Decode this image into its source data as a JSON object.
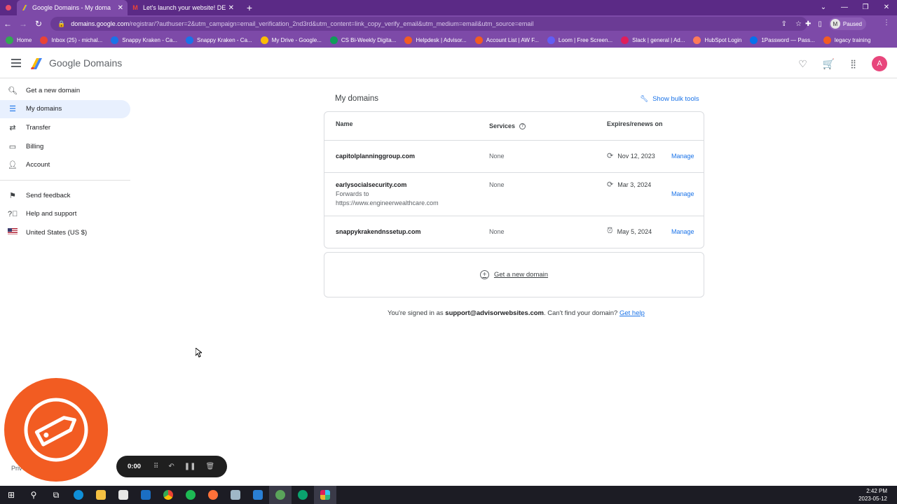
{
  "browser": {
    "tabs": [
      {
        "title": "Google Domains - My doma",
        "favicon": "google-domains-icon",
        "active": true
      },
      {
        "title": "Let's launch your website! DEMO",
        "favicon": "gmail-icon",
        "active": false
      }
    ],
    "url_host": "domains.google.com",
    "url_path": "/registrar/?authuser=2&utm_campaign=email_verification_2nd3rd&utm_content=link_copy_verify_email&utm_medium=email&utm_source=email",
    "profile_initial": "M",
    "profile_status": "Paused",
    "bookmarks": [
      {
        "label": "Home",
        "color": "#34a853"
      },
      {
        "label": "Inbox (25) - michal...",
        "color": "#ea4335"
      },
      {
        "label": "Snappy Kraken - Ca...",
        "color": "#1a73e8"
      },
      {
        "label": "Snappy Kraken - Ca...",
        "color": "#1a73e8"
      },
      {
        "label": "My Drive - Google...",
        "color": "#fbbc04"
      },
      {
        "label": "CS Bi-Weekly Digita...",
        "color": "#0f9d58"
      },
      {
        "label": "Helpdesk | Advisor...",
        "color": "#f25c22"
      },
      {
        "label": "Account List | AW F...",
        "color": "#f25c22"
      },
      {
        "label": "Loom | Free Screen...",
        "color": "#625df5"
      },
      {
        "label": "Slack | general | Ad...",
        "color": "#e01e5a"
      },
      {
        "label": "HubSpot Login",
        "color": "#ff7a59"
      },
      {
        "label": "1Password — Pass...",
        "color": "#0572ec"
      },
      {
        "label": "legacy training",
        "color": "#f25c22"
      }
    ]
  },
  "app": {
    "brand": "Google Domains",
    "avatar_initial": "A"
  },
  "sidebar": {
    "items": [
      {
        "label": "Get a new domain",
        "icon": "search-icon"
      },
      {
        "label": "My domains",
        "icon": "list-icon",
        "active": true
      },
      {
        "label": "Transfer",
        "icon": "transfer-icon"
      },
      {
        "label": "Billing",
        "icon": "credit-card-icon"
      },
      {
        "label": "Account",
        "icon": "person-icon"
      }
    ],
    "items2": [
      {
        "label": "Send feedback",
        "icon": "feedback-icon"
      },
      {
        "label": "Help and support",
        "icon": "help-icon"
      },
      {
        "label": "United States (US $)",
        "icon": "us-flag-icon"
      }
    ],
    "privacy": "Priv"
  },
  "main": {
    "title": "My domains",
    "bulk_tools": "Show bulk tools",
    "columns": {
      "name": "Name",
      "services": "Services",
      "expires": "Expires/renews on"
    },
    "rows": [
      {
        "domain": "capitolplanninggroup.com",
        "forwards_label": "",
        "forwards_url": "",
        "services": "None",
        "expires": "Nov 12, 2023",
        "expires_icon": "renew-icon",
        "action": "Manage"
      },
      {
        "domain": "earlysocialsecurity.com",
        "forwards_label": "Forwards to",
        "forwards_url": "https://www.engineerwealthcare.com",
        "services": "None",
        "expires": "Mar 3, 2024",
        "expires_icon": "renew-icon",
        "action": "Manage"
      },
      {
        "domain": "snappykrakendnssetup.com",
        "forwards_label": "",
        "forwards_url": "",
        "services": "None",
        "expires": "May 5, 2024",
        "expires_icon": "alarm-icon",
        "action": "Manage"
      }
    ],
    "get_new_domain": "Get a new domain",
    "signed_prefix": "You're signed in as ",
    "signed_email": "support@advisorwebsites.com",
    "signed_suffix": ". Can't find your domain? ",
    "get_help": "Get help"
  },
  "recorder": {
    "time": "0:00"
  },
  "taskbar": {
    "time": "2:42 PM",
    "date": "2023-05-12"
  },
  "colors": {
    "accent": "#1a73e8",
    "chrome": "#7d4aa8",
    "loom": "#f25c22"
  }
}
